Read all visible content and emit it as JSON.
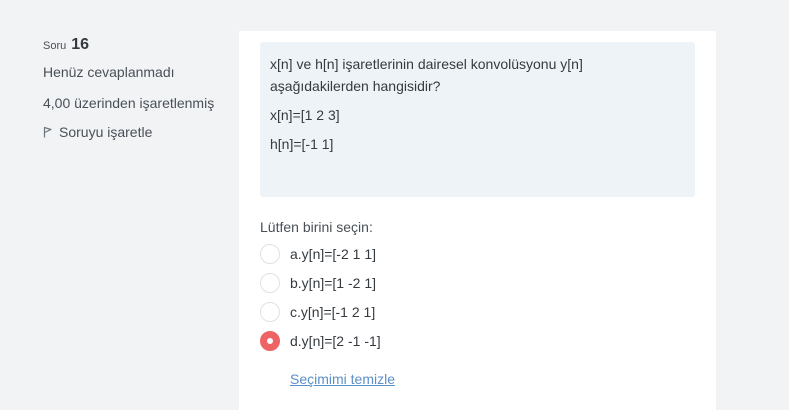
{
  "question_info": {
    "number_label": "Soru",
    "number": "16",
    "state": "Henüz cevaplanmadı",
    "grade": "4,00 üzerinden işaretlenmiş",
    "flag_label": "Soruyu işaretle"
  },
  "question": {
    "text": "x[n] ve h[n] işaretlerinin dairesel konvolüsyonu y[n] aşağıdakilerden hangisidir?",
    "x_def": "x[n]=[1 2 3]",
    "h_def": "h[n]=[-1 1]"
  },
  "answers": {
    "prompt": "Lütfen birini seçin:",
    "options": [
      {
        "label": "a.y[n]=[-2 1 1]",
        "selected": false
      },
      {
        "label": "b.y[n]=[1 -2 1]",
        "selected": false
      },
      {
        "label": "c.y[n]=[-1 2 1]",
        "selected": false
      },
      {
        "label": "d.y[n]=[2 -1 -1]",
        "selected": true
      }
    ],
    "clear_label": "Seçimimi temizle"
  },
  "colors": {
    "selected_radio": "#ee6464",
    "link": "#5b8fc7",
    "question_bg": "#eef3f7"
  },
  "icons": {
    "flag": "flag-icon"
  }
}
